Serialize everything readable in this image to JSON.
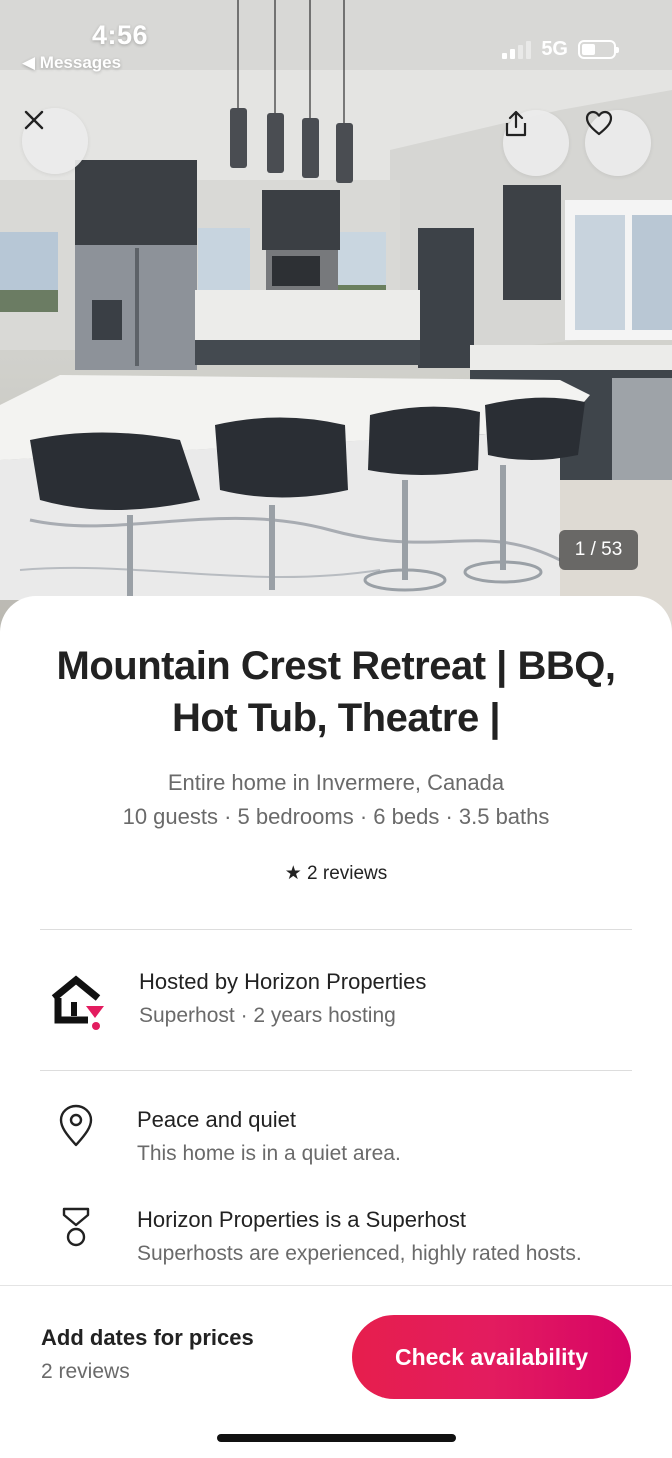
{
  "status": {
    "time": "4:56",
    "back_label": "Messages",
    "network": "5G"
  },
  "gallery": {
    "counter": "1 / 53"
  },
  "listing": {
    "title": "Mountain Crest Retreat | BBQ, Hot Tub, Theatre |",
    "subtitle": "Entire home in Invermere, Canada",
    "details": "10 guests · 5 bedrooms · 6 beds · 3.5 baths",
    "reviews": "2 reviews"
  },
  "host": {
    "name": "Hosted by Horizon Properties",
    "meta": "Superhost · 2 years hosting"
  },
  "features": [
    {
      "icon": "location-pin-icon",
      "title": "Peace and quiet",
      "subtitle": "This home is in a quiet area."
    },
    {
      "icon": "superhost-badge-icon",
      "title": "Horizon Properties is a Superhost",
      "subtitle": "Superhosts are experienced, highly rated hosts."
    }
  ],
  "footer": {
    "price_label": "Add dates for prices",
    "reviews": "2 reviews",
    "cta": "Check availability"
  },
  "colors": {
    "brand": "#e31c5f",
    "text": "#222222",
    "muted": "#6a6a6a"
  }
}
